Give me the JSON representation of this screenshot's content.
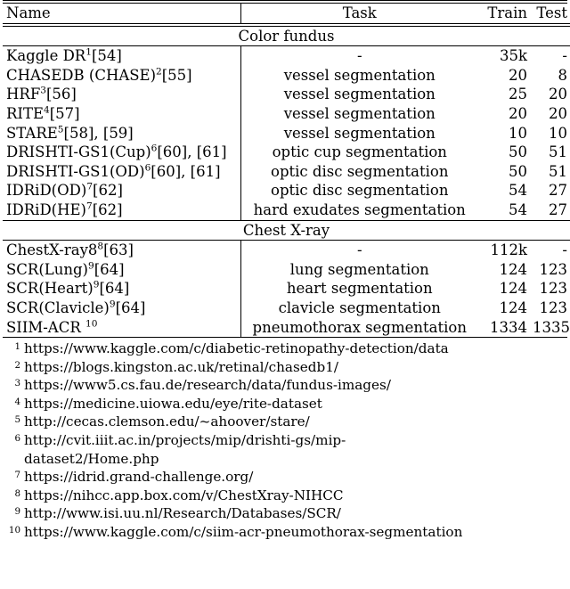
{
  "table": {
    "columns": [
      {
        "key": "name",
        "label": "Name",
        "align": "left"
      },
      {
        "key": "task",
        "label": "Task",
        "align": "center"
      },
      {
        "key": "train",
        "label": "Train",
        "align": "right"
      },
      {
        "key": "test",
        "label": "Test",
        "align": "right"
      }
    ],
    "sections": [
      {
        "title": "Color fundus",
        "rows": [
          {
            "name_text": "Kaggle DR",
            "name_sup": "1",
            "name_tail": "[54]",
            "task": "-",
            "train": "35k",
            "test": "-"
          },
          {
            "name_text": "CHASEDB (CHASE)",
            "name_sup": "2",
            "name_tail": "[55]",
            "task": "vessel segmentation",
            "train": "20",
            "test": "8"
          },
          {
            "name_text": "HRF",
            "name_sup": "3",
            "name_tail": "[56]",
            "task": "vessel segmentation",
            "train": "25",
            "test": "20"
          },
          {
            "name_text": "RITE",
            "name_sup": "4",
            "name_tail": "[57]",
            "task": "vessel segmentation",
            "train": "20",
            "test": "20"
          },
          {
            "name_text": "STARE",
            "name_sup": "5",
            "name_tail": "[58], [59]",
            "task": "vessel segmentation",
            "train": "10",
            "test": "10"
          },
          {
            "name_text": "DRISHTI-GS1(Cup)",
            "name_sup": "6",
            "name_tail": "[60], [61]",
            "task": "optic cup segmentation",
            "train": "50",
            "test": "51"
          },
          {
            "name_text": "DRISHTI-GS1(OD)",
            "name_sup": "6",
            "name_tail": "[60], [61]",
            "task": "optic disc segmentation",
            "train": "50",
            "test": "51"
          },
          {
            "name_text": "IDRiD(OD)",
            "name_sup": "7",
            "name_tail": "[62]",
            "task": "optic disc segmentation",
            "train": "54",
            "test": "27"
          },
          {
            "name_text": "IDRiD(HE)",
            "name_sup": "7",
            "name_tail": "[62]",
            "task": "hard exudates segmentation",
            "train": "54",
            "test": "27"
          }
        ]
      },
      {
        "title": "Chest X-ray",
        "rows": [
          {
            "name_text": "ChestX-ray8",
            "name_sup": "8",
            "name_tail": "[63]",
            "task": "-",
            "train": "112k",
            "test": "-"
          },
          {
            "name_text": "SCR(Lung)",
            "name_sup": "9",
            "name_tail": "[64]",
            "task": "lung segmentation",
            "train": "124",
            "test": "123"
          },
          {
            "name_text": "SCR(Heart)",
            "name_sup": "9",
            "name_tail": "[64]",
            "task": "heart segmentation",
            "train": "124",
            "test": "123"
          },
          {
            "name_text": "SCR(Clavicle)",
            "name_sup": "9",
            "name_tail": "[64]",
            "task": "clavicle segmentation",
            "train": "124",
            "test": "123"
          },
          {
            "name_text": "SIIM-ACR ",
            "name_sup": "10",
            "name_tail": "",
            "task": "pneumothorax segmentation",
            "train": "1334",
            "test": "1335"
          }
        ]
      }
    ]
  },
  "footnotes": [
    {
      "num": "1",
      "url": "https://www.kaggle.com/c/diabetic-retinopathy-detection/data",
      "cont": ""
    },
    {
      "num": "2",
      "url": "https://blogs.kingston.ac.uk/retinal/chasedb1/",
      "cont": ""
    },
    {
      "num": "3",
      "url": "https://www5.cs.fau.de/research/data/fundus-images/",
      "cont": ""
    },
    {
      "num": "4",
      "url": "https://medicine.uiowa.edu/eye/rite-dataset",
      "cont": ""
    },
    {
      "num": "5",
      "url": "http://cecas.clemson.edu/~ahoover/stare/",
      "cont": ""
    },
    {
      "num": "6",
      "url": "http://cvit.iiit.ac.in/projects/mip/drishti-gs/mip-",
      "cont": "dataset2/Home.php"
    },
    {
      "num": "7",
      "url": "https://idrid.grand-challenge.org/",
      "cont": ""
    },
    {
      "num": "8",
      "url": "https://nihcc.app.box.com/v/ChestXray-NIHCC",
      "cont": ""
    },
    {
      "num": "9",
      "url": "http://www.isi.uu.nl/Research/Databases/SCR/",
      "cont": ""
    },
    {
      "num": "10",
      "url": "https://www.kaggle.com/c/siim-acr-pneumothorax-segmentation",
      "cont": ""
    }
  ]
}
